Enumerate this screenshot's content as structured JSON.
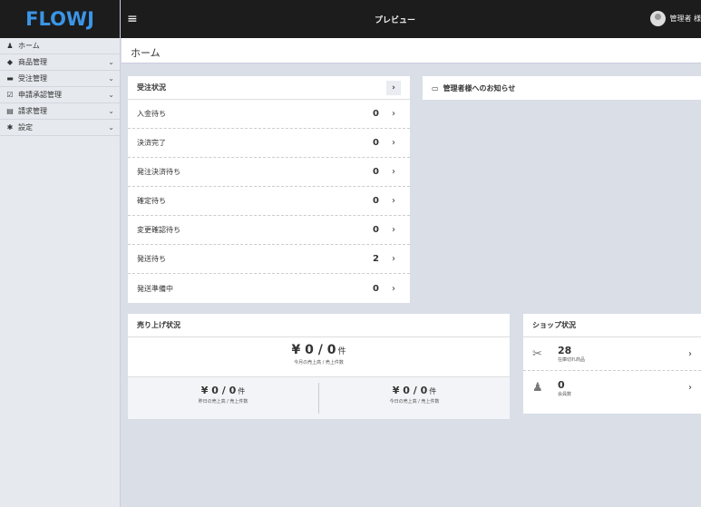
{
  "brand": "FLOWJ",
  "header": {
    "title": "プレビュー",
    "user": "管理者 様"
  },
  "sidebar": {
    "items": [
      {
        "icon": "♟",
        "label": "ホーム",
        "chevron": ""
      },
      {
        "icon": "◆",
        "label": "商品管理",
        "chevron": "⌄"
      },
      {
        "icon": "▬",
        "label": "受注管理",
        "chevron": "⌄"
      },
      {
        "icon": "☑",
        "label": "申請承認管理",
        "chevron": "⌄"
      },
      {
        "icon": "▤",
        "label": "請求管理",
        "chevron": "⌄"
      },
      {
        "icon": "✱",
        "label": "設定",
        "chevron": "⌄"
      }
    ]
  },
  "breadcrumb": "ホーム",
  "orders": {
    "title": "受注状況",
    "rows": [
      {
        "label": "入金待ち",
        "count": "0"
      },
      {
        "label": "決済完了",
        "count": "0"
      },
      {
        "label": "発注決済待ち",
        "count": "0"
      },
      {
        "label": "確定待ち",
        "count": "0"
      },
      {
        "label": "変更確認待ち",
        "count": "0"
      },
      {
        "label": "発送待ち",
        "count": "2"
      },
      {
        "label": "発送準備中",
        "count": "0"
      }
    ]
  },
  "notice": {
    "title": "管理者様へのお知らせ"
  },
  "sales": {
    "title": "売り上げ状況",
    "month": {
      "amount": "¥ 0 / 0",
      "unit": "件",
      "caption": "今月の売上高 / 売上件数"
    },
    "yesterday": {
      "amount": "¥ 0 / 0",
      "unit": "件",
      "caption": "昨日の売上高 / 売上件数"
    },
    "today": {
      "amount": "¥ 0 / 0",
      "unit": "件",
      "caption": "今日の売上高 / 売上件数"
    }
  },
  "shop": {
    "title": "ショップ状況",
    "out_of_stock": {
      "value": "28",
      "caption": "在庫切れ商品"
    },
    "members": {
      "value": "0",
      "caption": "会員数"
    }
  },
  "colors": {
    "brand_blue": "#3a95e6",
    "topbar": "#1c1c1c",
    "background": "#d9dee7"
  }
}
